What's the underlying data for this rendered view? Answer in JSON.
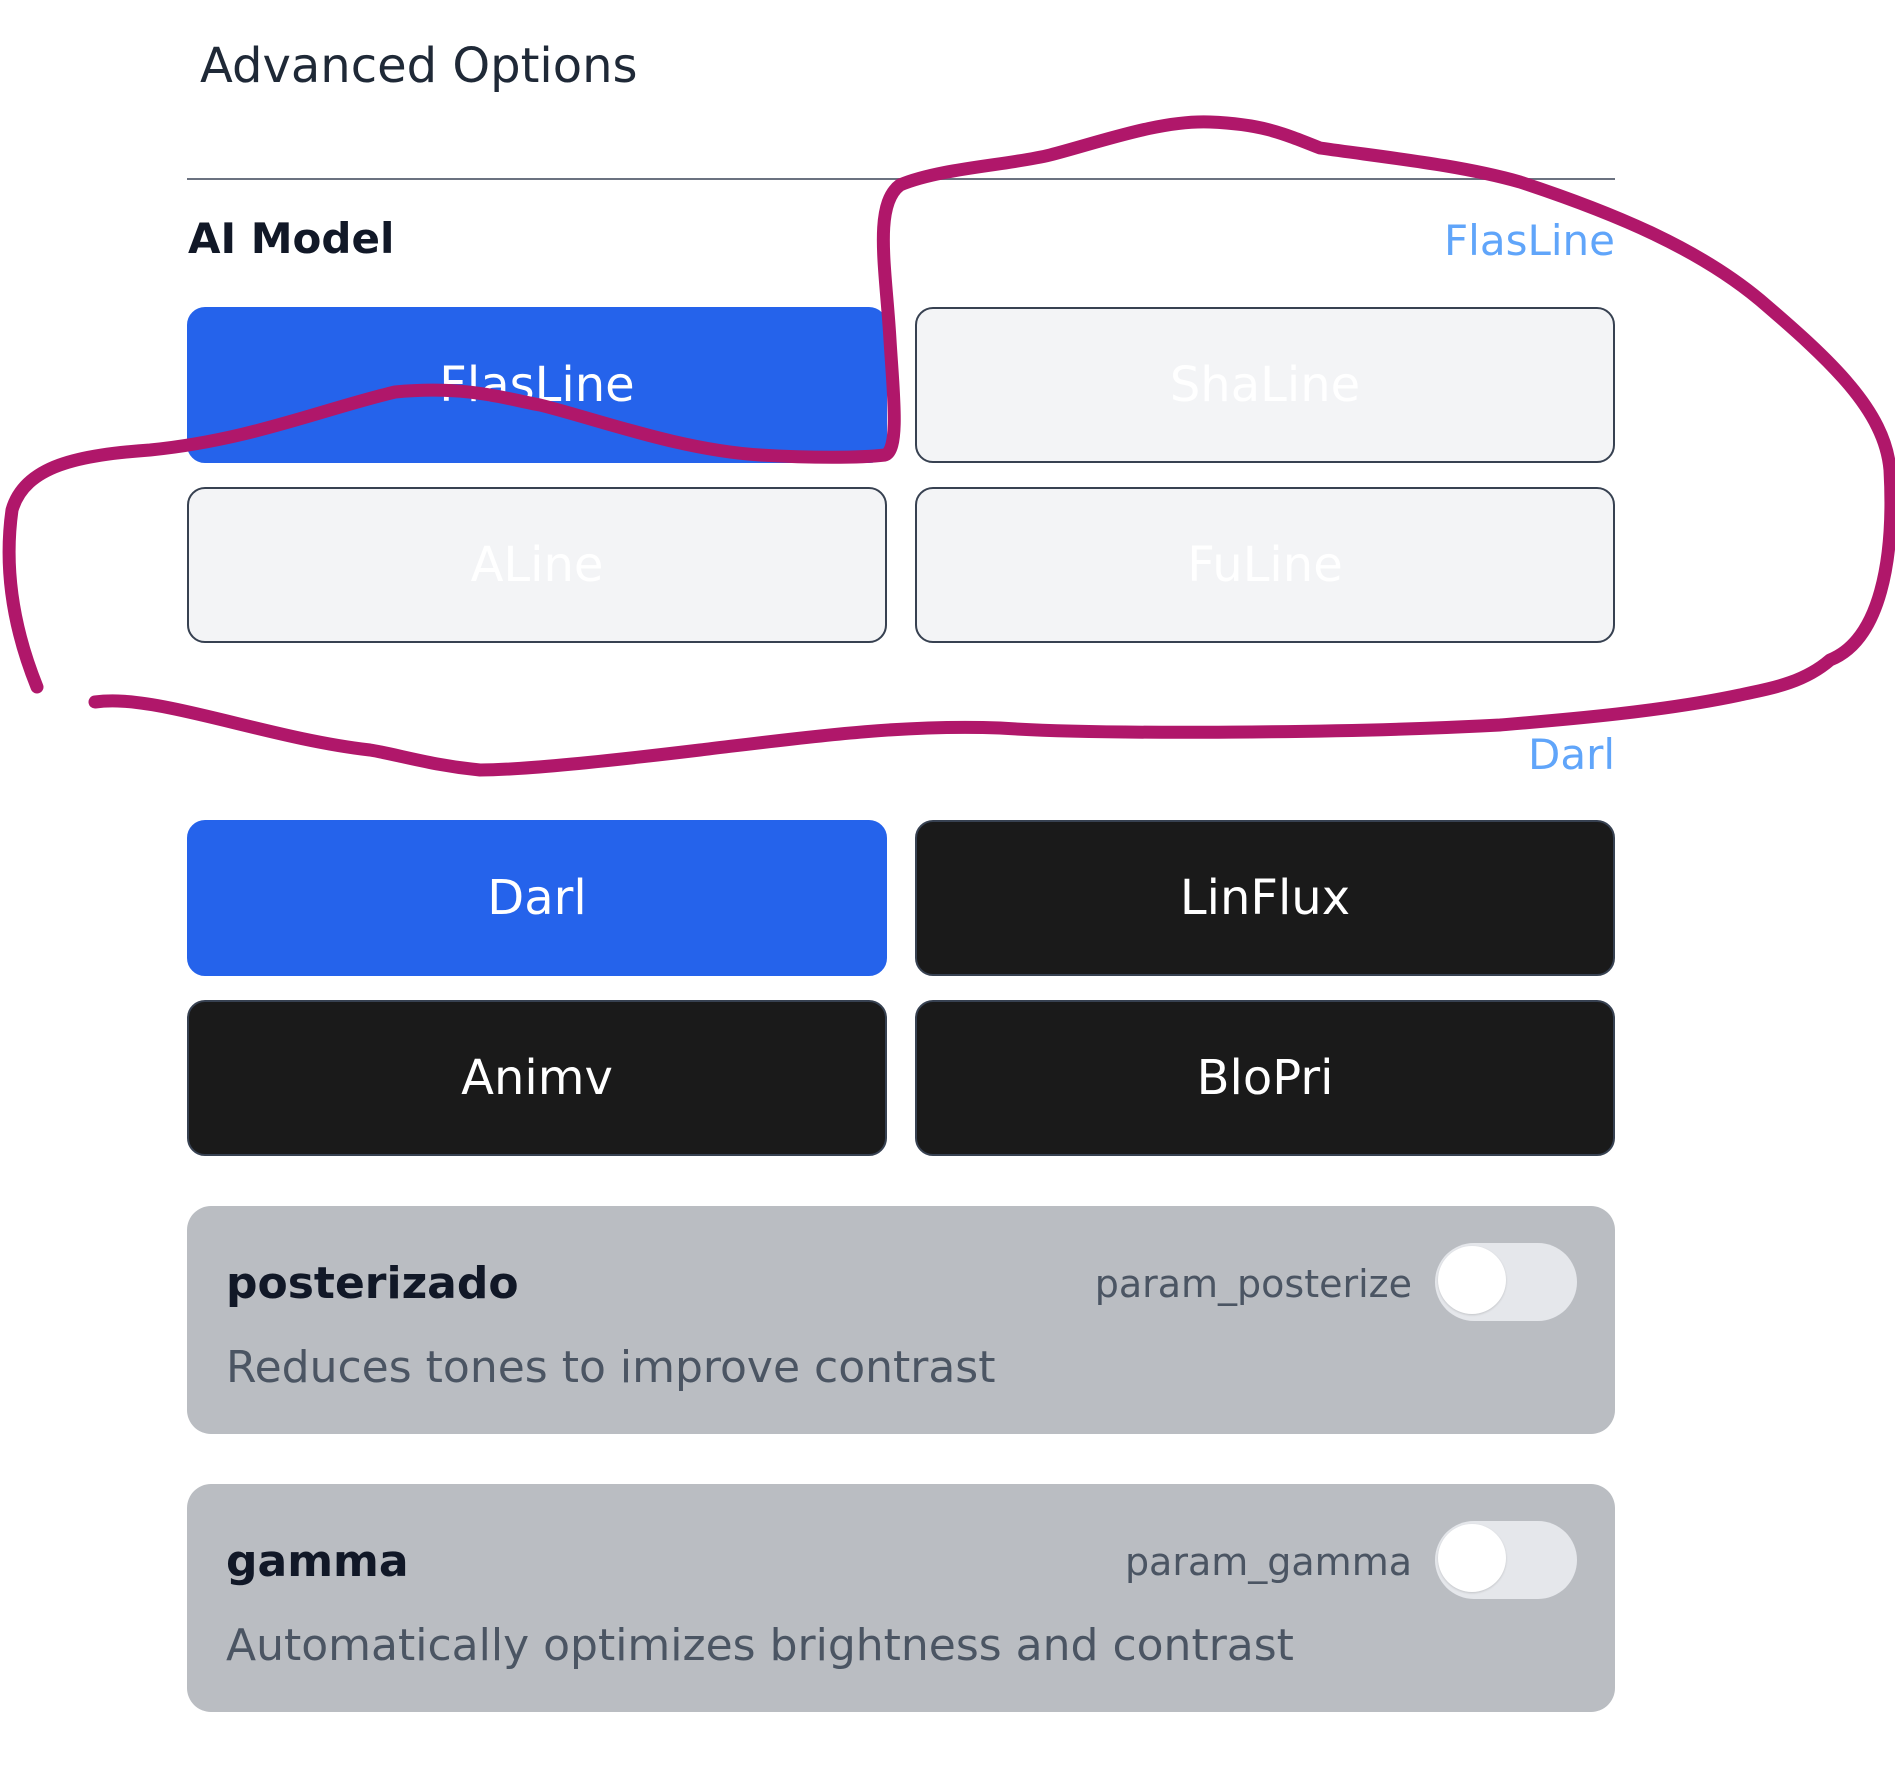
{
  "page": {
    "title": "Advanced Options"
  },
  "ai_model": {
    "label": "AI Model",
    "group1": {
      "selected": "FlasLine",
      "options": [
        "FlasLine",
        "ShaLine",
        "ALine",
        "FuLine"
      ]
    },
    "group2": {
      "selected": "Darl",
      "options": [
        "Darl",
        "LinFlux",
        "Animv",
        "BloPri"
      ]
    }
  },
  "settings": [
    {
      "title": "posterizado",
      "param": "param_posterize",
      "description": "Reduces tones to improve contrast",
      "enabled": false
    },
    {
      "title": "gamma",
      "param": "param_gamma",
      "description": "Automatically optimizes brightness and contrast",
      "enabled": false
    }
  ],
  "colors": {
    "accent": "#2563eb",
    "selected_text": "#60a5fa",
    "card_bg": "#babdc2",
    "dark_button": "#1a1a1a",
    "light_button": "#f3f4f6",
    "annotation": "#b0176a"
  }
}
